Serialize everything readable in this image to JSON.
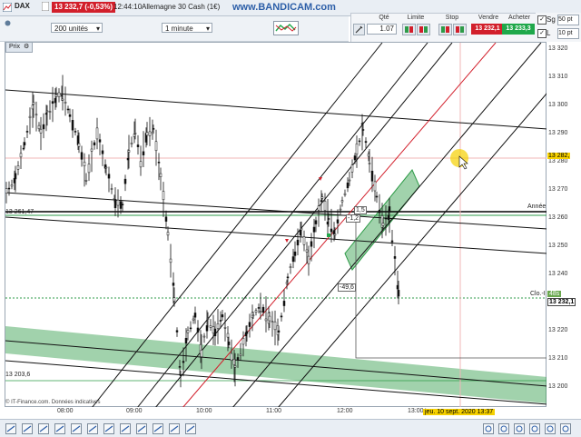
{
  "topbar": {
    "instrument": "DAX",
    "price_change": "13 232,7 (-0,53%)",
    "clock": "12:44:10",
    "product": "Allemagne 30 Cash (1€)",
    "watermark": "www.BANDICAM.com"
  },
  "toolbar": {
    "units_select": "200 unités",
    "interval_select": "1 minute",
    "prix_tab": "Prix"
  },
  "order_panel": {
    "qty_label": "Qté",
    "qty_value": "1.07",
    "limit_label": "Limite",
    "stop_label": "Stop",
    "sell_label": "Vendre",
    "sell_price": "13 232,1",
    "buy_label": "Acheter",
    "buy_price": "13 233,3"
  },
  "right_checks": {
    "sg": "Sg",
    "sg_val": "50 pt",
    "l": "L",
    "l_val": "10 pt"
  },
  "chart": {
    "price_ticks": [
      "13 320",
      "13 310",
      "13 300",
      "13 290",
      "13 280",
      "13 270",
      "13 260",
      "13 250",
      "13 240",
      "13 230",
      "13 220",
      "13 210",
      "13 200"
    ],
    "time_ticks": [
      "08:00",
      "09:00",
      "10:00",
      "11:00",
      "12:00",
      "13:00"
    ],
    "current_price_label": "13 232,1",
    "hover_price_label": "13 282,",
    "level_label_1": "13 261,47",
    "level_label_2": "13 203,6",
    "annee_label": "Année",
    "clo_label": "Clo.-I",
    "countdown": "48s",
    "measure_1": "-1,2",
    "measure_2": "-49,6",
    "measure_3": "1,5",
    "cursor_date": "jeu. 10 sept. 2020 13:37",
    "credit": "© IT-Finance.com. Données indicatives"
  },
  "colors": {
    "accent_red": "#d21f2b",
    "accent_green": "#1fa84a",
    "band_green": "#2e9b48",
    "cursor_yellow": "#f5d000"
  }
}
